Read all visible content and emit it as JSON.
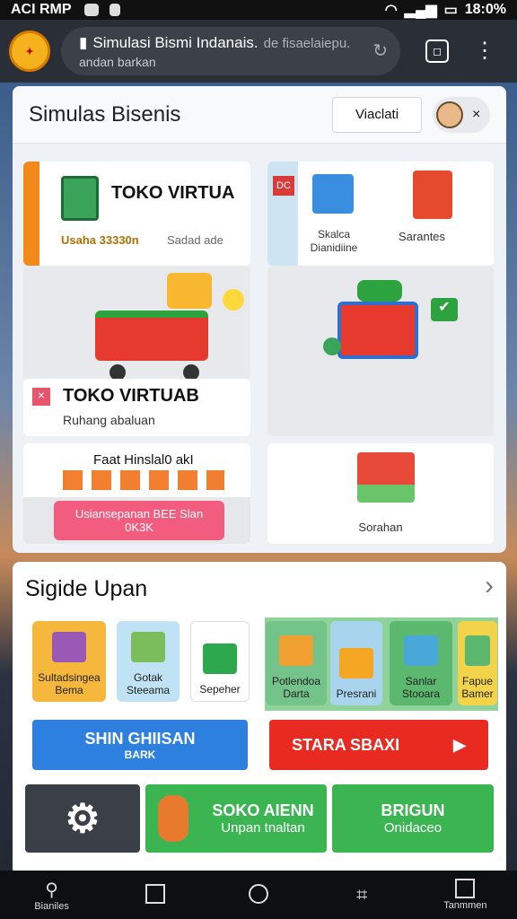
{
  "status": {
    "carrier": "ACI RMP",
    "time": "18:0%"
  },
  "browser": {
    "title": "Simulasi Bismi Indanais.",
    "title_dim": "de fisaelaiepu.",
    "subtitle": "andan barkan",
    "logo": "logo"
  },
  "header": {
    "title": "Simulas Bisenis",
    "view_button": "Viaclati",
    "close": "×"
  },
  "panels": {
    "toko1_title": "TOKO VIRTUA",
    "toko1_sub1": "Usaha 33330n",
    "toko1_sub2": "Sadad ade",
    "stock_label": "Skalca Dianidiine",
    "barang_label": "Sarantes",
    "toko2_title": "TOKO VIRTUAB",
    "toko2_sub": "Ruhang abaluan",
    "promo_title": "Faat Hinslal0 akI",
    "promo_button_line1": "Usiansepanan BEE Slan",
    "promo_button_line2": "0K3K",
    "store_label": "Sorahan"
  },
  "section": {
    "title": "Sigide Upan",
    "chevron": "›"
  },
  "tiles": [
    {
      "label": "Sultadsingea Bema",
      "color": "#f5b83d",
      "icon": "#9b59b6"
    },
    {
      "label": "Gotak Steeama",
      "color": "#bfe3f5",
      "icon": "#7bbd5b"
    },
    {
      "label": "Sepeher",
      "color": "#ffffff",
      "icon": "#2ea84f"
    },
    {
      "label": "Potlendoa Darta",
      "color": "#74c38a",
      "icon": "#f0a030"
    },
    {
      "label": "Presrani",
      "color": "#a8d4ee",
      "icon": "#f5a623"
    },
    {
      "label": "Sanlar Stooara",
      "color": "#5cb86e",
      "icon": "#4aa8d8"
    },
    {
      "label": "Fapue Bamer",
      "color": "#f3d34a",
      "icon": "#5cb86e"
    }
  ],
  "buttons": {
    "blue_line1": "SHIN GHIISAN",
    "blue_line2": "BARK",
    "red": "STARA SBAXI",
    "red_arrow": "▶",
    "green1_line1": "SOKO AIENN",
    "green1_line2": "Unpan tnaltan",
    "green2_line1": "BRIGUN",
    "green2_line2": "Onidaceo"
  },
  "nav": [
    {
      "label": "Bianiles"
    },
    {
      "label": ""
    },
    {
      "label": ""
    },
    {
      "label": ""
    },
    {
      "label": "Tanmmen"
    }
  ]
}
